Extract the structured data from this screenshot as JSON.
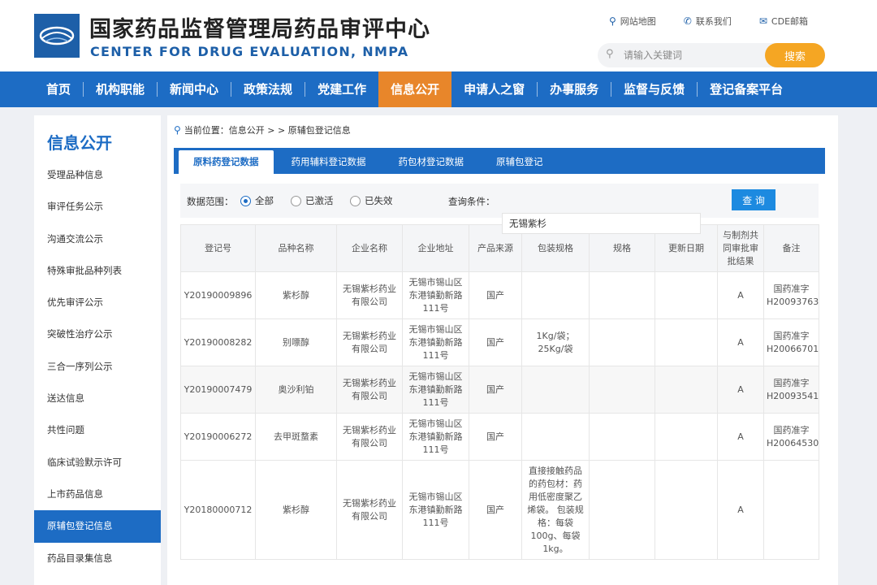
{
  "header": {
    "title_cn": "国家药品监督管理局药品审评中心",
    "title_en": "CENTER FOR DRUG EVALUATION, NMPA",
    "links": [
      {
        "label": "网站地图",
        "icon": "location-pin-icon"
      },
      {
        "label": "联系我们",
        "icon": "phone-icon"
      },
      {
        "label": "CDE邮箱",
        "icon": "mail-icon"
      }
    ],
    "search_placeholder": "请输入关键词",
    "search_button": "搜索"
  },
  "nav": {
    "items": [
      "首页",
      "机构职能",
      "新闻中心",
      "政策法规",
      "党建工作",
      "信息公开",
      "申请人之窗",
      "办事服务",
      "监督与反馈",
      "登记备案平台"
    ],
    "active_index": 5
  },
  "sidebar": {
    "title": "信息公开",
    "items": [
      "受理品种信息",
      "审评任务公示",
      "沟通交流公示",
      "特殊审批品种列表",
      "优先审评公示",
      "突破性治疗公示",
      "三合一序列公示",
      "送达信息",
      "共性问题",
      "临床试验默示许可",
      "上市药品信息",
      "原辅包登记信息",
      "药品目录集信息"
    ],
    "active_index": 11
  },
  "breadcrumb": {
    "text": "当前位置：信息公开 > > 原辅包登记信息"
  },
  "tabs": {
    "items": [
      "原料药登记数据",
      "药用辅料登记数据",
      "药包材登记数据",
      "原辅包登记"
    ],
    "active_index": 0
  },
  "filter": {
    "range_label": "数据范围：",
    "options": [
      "全部",
      "已激活",
      "已失效"
    ],
    "selected_index": 0,
    "query_label": "查询条件：",
    "query_value": "无锡紫杉",
    "query_button": "查 询"
  },
  "table": {
    "headers": [
      "登记号",
      "品种名称",
      "企业名称",
      "企业地址",
      "产品来源",
      "包装规格",
      "规格",
      "更新日期",
      "与制剂共同审批审批结果",
      "备注"
    ],
    "rows": [
      [
        "Y20190009896",
        "紫杉醇",
        "无锡紫杉药业有限公司",
        "无锡市锡山区东港镇勤新路111号",
        "国产",
        "",
        "",
        "",
        "A",
        "国药准字H20093763"
      ],
      [
        "Y20190008282",
        "别嘌醇",
        "无锡紫杉药业有限公司",
        "无锡市锡山区东港镇勤新路111号",
        "国产",
        "1Kg/袋；25Kg/袋",
        "",
        "",
        "A",
        "国药准字H20066701"
      ],
      [
        "Y20190007479",
        "奥沙利铂",
        "无锡紫杉药业有限公司",
        "无锡市锡山区东港镇勤新路111号",
        "国产",
        "",
        "",
        "",
        "A",
        "国药准字H20093541"
      ],
      [
        "Y20190006272",
        "去甲斑蝥素",
        "无锡紫杉药业有限公司",
        "无锡市锡山区东港镇勤新路111号",
        "国产",
        "",
        "",
        "",
        "A",
        "国药准字H20064530"
      ],
      [
        "Y20180000712",
        "紫杉醇",
        "无锡紫杉药业有限公司",
        "无锡市锡山区东港镇勤新路111号",
        "国产",
        "直接接触药品的药包材：药用低密度聚乙烯袋。 包装规格：每袋100g、每袋1kg。",
        "",
        "",
        "A",
        ""
      ]
    ]
  },
  "colors": {
    "brand_blue": "#1d6cc4",
    "active_orange": "#e8862a",
    "search_orange": "#f5a623"
  }
}
